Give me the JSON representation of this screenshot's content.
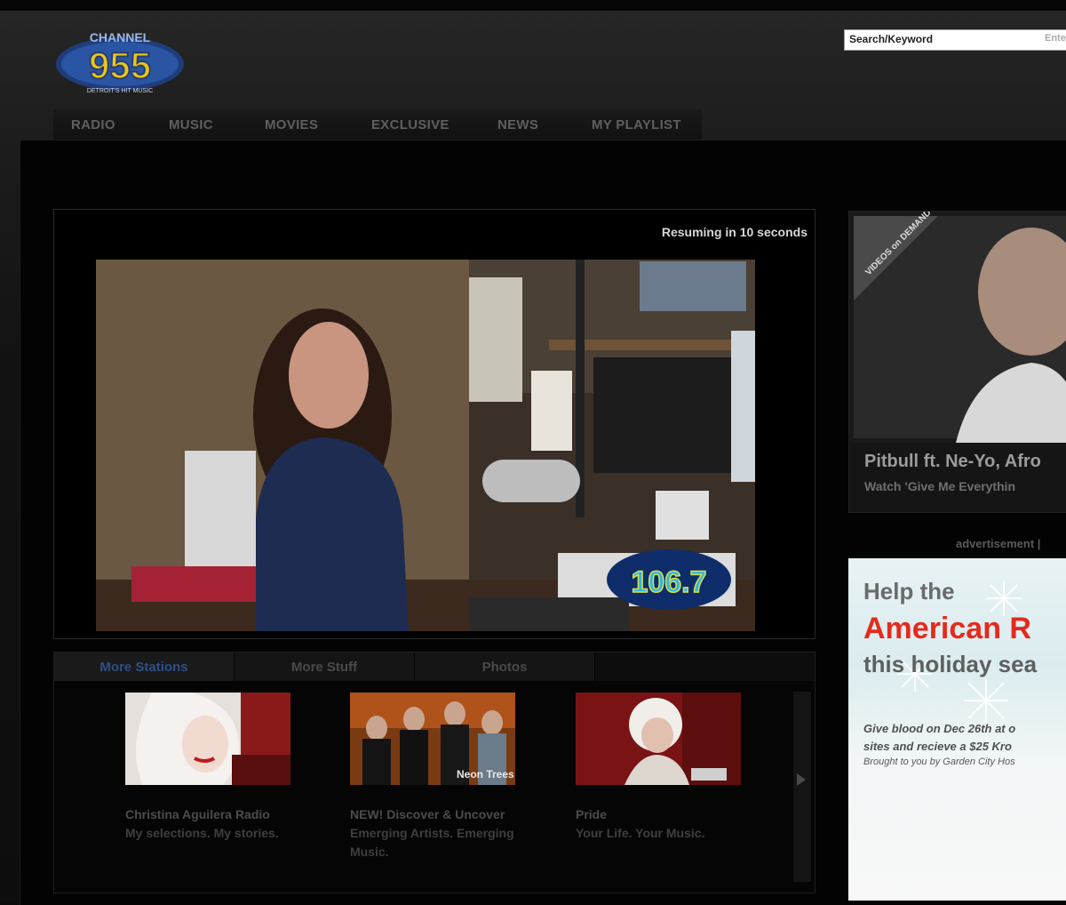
{
  "site": {
    "logo_text": "CHANNEL 955",
    "logo_tagline": "DETROIT'S HIT MUSIC"
  },
  "search": {
    "placeholder": "Search/Keyword",
    "enter_label": "Enter"
  },
  "nav": {
    "items": [
      "RADIO",
      "MUSIC",
      "MOVIES",
      "EXCLUSIVE",
      "NEWS",
      "MY PLAYLIST"
    ]
  },
  "player": {
    "status_text": "Resuming in 10 seconds",
    "station_logo": "106.7"
  },
  "tabs": {
    "items": [
      {
        "label": "More Stations",
        "active": true
      },
      {
        "label": "More Stuff",
        "active": false
      },
      {
        "label": "Photos",
        "active": false
      }
    ]
  },
  "stations": [
    {
      "title": "Christina Aguilera Radio",
      "description": "My selections. My stories."
    },
    {
      "title": "NEW! Discover & Uncover",
      "description": "Emerging Artists. Emerging Music.",
      "thumb_text": "Neon Trees"
    },
    {
      "title": "Pride",
      "description": "Your Life. Your Music."
    }
  ],
  "promo": {
    "badge": "VIDEOS on DEMAND",
    "title": "Pitbull ft. Ne-Yo, Afro",
    "subtitle": "Watch 'Give Me Everythin"
  },
  "advertisement": {
    "label": "advertisement |",
    "line1": "Help the",
    "line2": "American R",
    "line3": "this holiday sea",
    "line4": "Give blood on Dec 26th at o",
    "line5": "sites and recieve a $25 Kro",
    "line6": "Brought to you by Garden City Hos"
  },
  "colors": {
    "accent_blue": "#2e4f86",
    "ad_red": "#e52a1c",
    "background": "#0b0b0b"
  }
}
